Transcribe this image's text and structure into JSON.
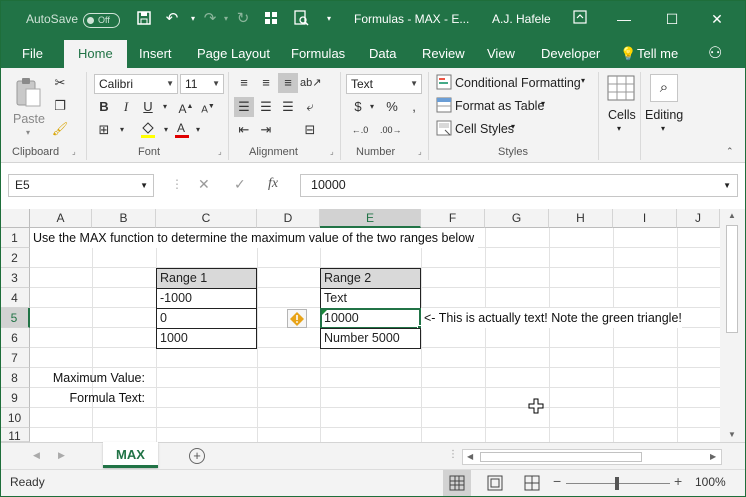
{
  "titlebar": {
    "autosave_label": "AutoSave",
    "autosave_state": "Off",
    "title": "Formulas - MAX  -  E...",
    "user": "A.J. Hafele"
  },
  "tabs": [
    "File",
    "Home",
    "Insert",
    "Page Layout",
    "Formulas",
    "Data",
    "Review",
    "View",
    "Developer",
    "Tell me"
  ],
  "ribbon": {
    "clipboard": {
      "paste_label": "Paste",
      "group_label": "Clipboard"
    },
    "font": {
      "name": "Calibri",
      "size": "11",
      "group_label": "Font",
      "bold": "B",
      "italic": "I",
      "underline": "U"
    },
    "alignment": {
      "group_label": "Alignment"
    },
    "number": {
      "format": "Text",
      "currency": "$",
      "percent": "%",
      "group_label": "Number"
    },
    "styles": {
      "conditional_formatting": "Conditional Formatting",
      "format_as_table": "Format as Table",
      "cell_styles": "Cell Styles",
      "group_label": "Styles"
    },
    "cells_label": "Cells",
    "editing_label": "Editing"
  },
  "formula_bar": {
    "name_box": "E5",
    "fx": "fx",
    "value": "10000"
  },
  "columns": [
    "A",
    "B",
    "C",
    "D",
    "E",
    "F",
    "G",
    "H",
    "I",
    "J"
  ],
  "rows": [
    "1",
    "2",
    "3",
    "4",
    "5",
    "6",
    "7",
    "8",
    "9",
    "10",
    "11"
  ],
  "cells": {
    "A1": "Use the MAX function to determine the maximum value of the two ranges below",
    "C3": "Range 1",
    "C4": "-1000",
    "C5": "0",
    "C6": "1000",
    "E3": "Range 2",
    "E4": "Text",
    "E5": "10000",
    "E6": "Number 5000",
    "F5": "<- This is actually text!  Note the green triangle!",
    "A8": "Maximum Value:",
    "A9": "Formula Text:"
  },
  "sheet_tab": "MAX",
  "status": {
    "mode": "Ready",
    "zoom": "100%"
  },
  "colors": {
    "accent": "#217346",
    "header_fill": "#d9d9d9",
    "warning": "#e8a317"
  }
}
